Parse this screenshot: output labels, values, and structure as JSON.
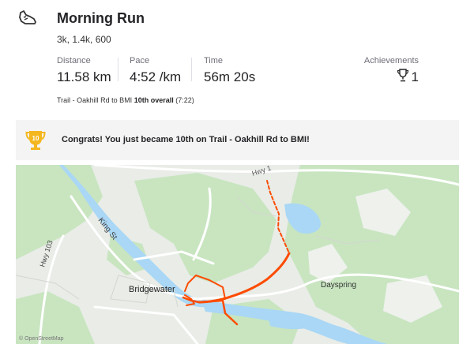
{
  "activity": {
    "icon": "running-shoe-icon",
    "title": "Morning Run",
    "subtitle": "3k, 1.4k, 600"
  },
  "stats": [
    {
      "label": "Distance",
      "value": "11.58 km"
    },
    {
      "label": "Pace",
      "value": "4:52 /km"
    },
    {
      "label": "Time",
      "value": "56m 20s"
    }
  ],
  "achievements": {
    "label": "Achievements",
    "icon": "trophy-icon",
    "count": "1"
  },
  "segment_line": {
    "segment": "Trail - Oakhill Rd to BMI",
    "rank": "10th overall",
    "time": "(7:22)"
  },
  "banner": {
    "badge_number": "10",
    "icon": "trophy-icon",
    "message": "Congrats! You just became 10th on Trail - Oakhill Rd to BMI!"
  },
  "map": {
    "labels": {
      "road_hwy_top": "Hwy 1",
      "road_king": "King St",
      "road_hwy103": "Hwy 103",
      "town_bridgewater": "Bridgewater",
      "town_dayspring": "Dayspring",
      "attribution": "© OpenStreetMap"
    },
    "colors": {
      "route": "#fc4c02",
      "water": "#a9d7f5",
      "forest": "#c8e5c0",
      "land": "#e9ece7"
    }
  }
}
